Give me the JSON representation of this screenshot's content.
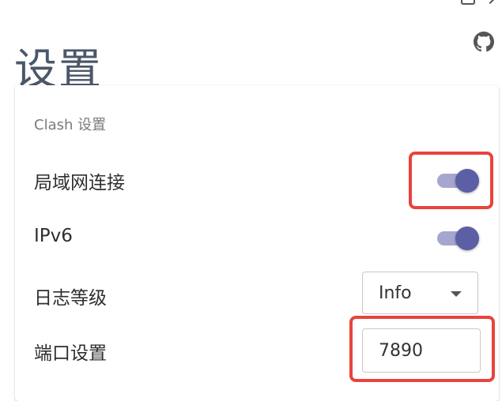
{
  "page": {
    "title": "设置"
  },
  "header": {
    "github_icon": "github-icon",
    "partial_icons": [
      "square-icon",
      "chevron-icon"
    ]
  },
  "clash_settings": {
    "section_title": "Clash 设置",
    "lan": {
      "label": "局域网连接",
      "enabled": true
    },
    "ipv6": {
      "label": "IPv6",
      "enabled": true
    },
    "log_level": {
      "label": "日志等级",
      "selected": "Info"
    },
    "port": {
      "label": "端口设置",
      "value": "7890"
    }
  },
  "colors": {
    "accent": "#5c5ea6",
    "accent_track": "#a7a6cf",
    "highlight": "#e8443d",
    "title": "#4a5868"
  }
}
